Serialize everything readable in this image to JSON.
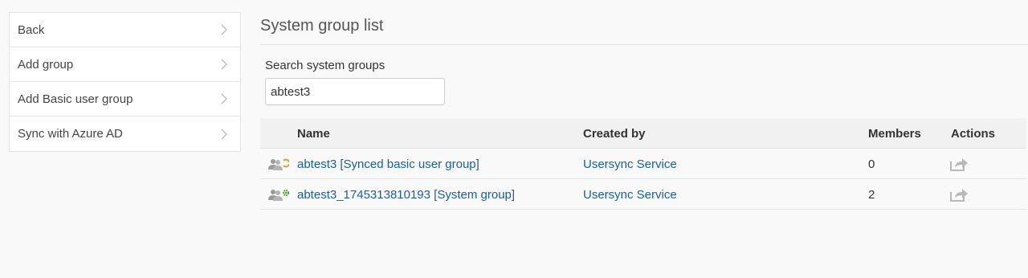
{
  "sidebar": {
    "items": [
      {
        "label": "Back"
      },
      {
        "label": "Add group"
      },
      {
        "label": "Add Basic user group"
      },
      {
        "label": "Sync with Azure AD"
      }
    ]
  },
  "main": {
    "title": "System group list",
    "search": {
      "label": "Search system groups",
      "value": "abtest3"
    },
    "table": {
      "columns": [
        "Name",
        "Created by",
        "Members",
        "Actions"
      ],
      "rows": [
        {
          "icon": "synced-group-icon",
          "name": "abtest3 [Synced basic user group]",
          "created_by": "Usersync Service",
          "members": "0",
          "action_icon": "share-icon"
        },
        {
          "icon": "system-group-icon",
          "name": "abtest3_1745313810193 [System group]",
          "created_by": "Usersync Service",
          "members": "2",
          "action_icon": "share-icon"
        }
      ]
    }
  },
  "colors": {
    "link": "#1a5fa0",
    "sync_badge": "#e8a020",
    "gear_badge": "#4aa02a",
    "group_icon": "#999999"
  }
}
